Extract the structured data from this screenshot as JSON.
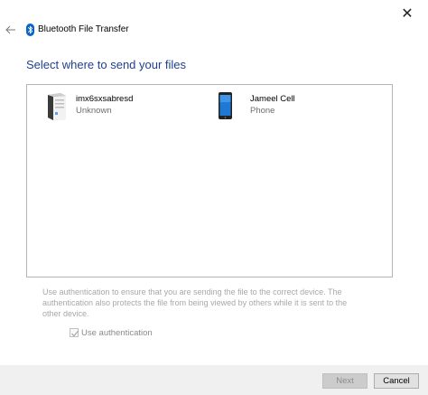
{
  "window": {
    "title": "Bluetooth File Transfer",
    "close_glyph": "✕",
    "back_icon": "back-arrow-icon",
    "title_icon": "bluetooth-icon",
    "accent_color": "#1f3f8f"
  },
  "main": {
    "heading": "Select where to send your files",
    "devices": [
      {
        "name": "imx6sxsabresd",
        "type": "Unknown",
        "icon": "computer-tower-icon"
      },
      {
        "name": "Jameel Cell",
        "type": "Phone",
        "icon": "phone-icon"
      }
    ],
    "auth_description": "Use authentication to ensure that you are sending the file to the correct device. The authentication also protects the file from being viewed by others while it is sent to the other device.",
    "auth_checkbox": {
      "label": "Use authentication",
      "checked": true,
      "enabled": false
    }
  },
  "footer": {
    "next_label": "Next",
    "cancel_label": "Cancel"
  }
}
